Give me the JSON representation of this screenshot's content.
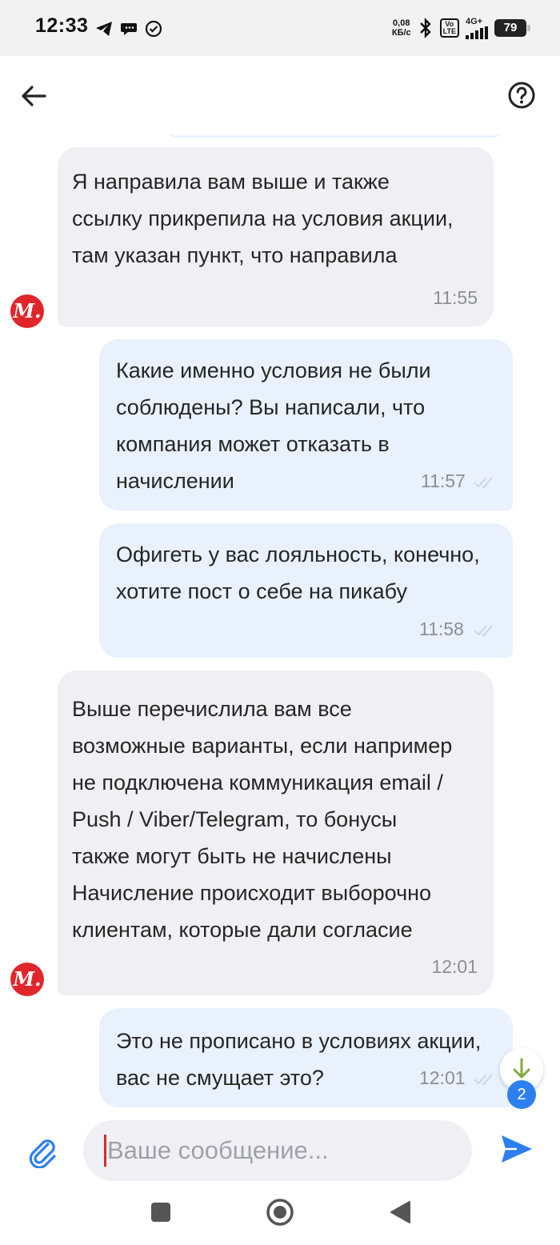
{
  "status_bar": {
    "time": "12:33",
    "speed_value": "0,08",
    "speed_unit": "КБ/с",
    "volte_top": "Vo",
    "volte_bottom": "LTE",
    "network": "4G+",
    "battery": "79"
  },
  "messages": [
    {
      "direction": "incoming",
      "text": "Я направила вам выше и также\nссылку прикрепила на условия акции,\nтам указан пункт, что направила",
      "time": "11:55"
    },
    {
      "direction": "outgoing",
      "text": "Какие именно условия не были\nсоблюдены? Вы написали, что\nкомпания может отказать в\nначислении",
      "time": "11:57"
    },
    {
      "direction": "outgoing",
      "text": "Офигеть у вас лояльность, конечно,\nхотите пост о себе на пикабу",
      "time": "11:58"
    },
    {
      "direction": "incoming",
      "text": "Выше перечислила вам все\nвозможные варианты, если например\nне подключена коммуникация email /\nPush / Viber/Telegram, то бонусы\nтакже могут быть не начислены\nНачисление происходит выборочно\nклиентам, которые дали согласие",
      "time": "12:01"
    },
    {
      "direction": "outgoing",
      "text": "Это не прописано в условиях акции,\nвас не смущает это?",
      "time": "12:01"
    }
  ],
  "avatar_letter": "М.",
  "unread_count": "2",
  "input": {
    "placeholder": "Ваше сообщение..."
  },
  "colors": {
    "incoming_bubble": "#f0f0f4",
    "outgoing_bubble": "#e8f1fc",
    "brand_red": "#e0262b",
    "accent_blue": "#2d7ff0"
  },
  "icons": [
    "back-arrow-icon",
    "help-icon",
    "paperclip-icon",
    "send-icon",
    "scroll-down-icon",
    "read-ticks-icon"
  ]
}
